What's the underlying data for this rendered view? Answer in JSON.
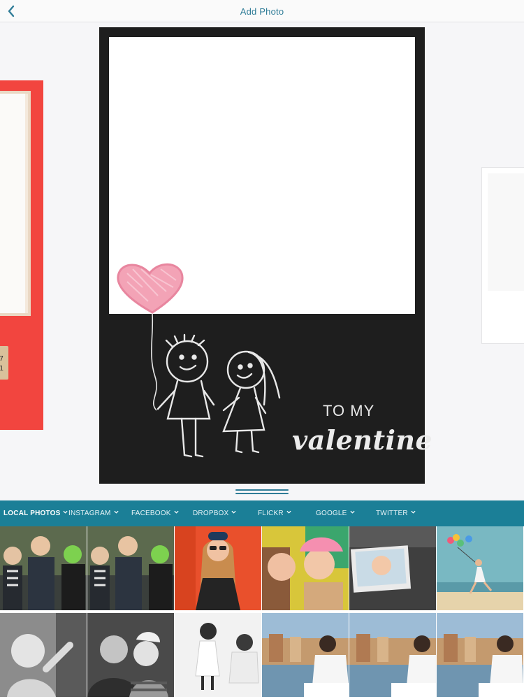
{
  "header": {
    "title": "Add Photo",
    "back_icon": "chevron-left-icon"
  },
  "colors": {
    "accent": "#2f7c97",
    "tab_bar": "#1b7f97",
    "chalkboard": "#1e1e1e",
    "left_card": "#f2453f"
  },
  "canvas": {
    "center_card": {
      "text_line1": "TO MY",
      "text_line2": "valentine"
    },
    "left_card": {
      "tag_text": "7\n1"
    }
  },
  "sources": {
    "tabs": [
      {
        "label": "LOCAL PHOTOS",
        "active": true
      },
      {
        "label": "INSTAGRAM",
        "active": false
      },
      {
        "label": "FACEBOOK",
        "active": false
      },
      {
        "label": "DROPBOX",
        "active": false
      },
      {
        "label": "FLICKR",
        "active": false
      },
      {
        "label": "GOOGLE",
        "active": false
      },
      {
        "label": "TWITTER",
        "active": false
      }
    ]
  },
  "photos": {
    "row1": [
      "kids-halloween-costumes-1",
      "kids-halloween-costumes-2",
      "woman-sunglasses-red-wall",
      "two-women-selfie",
      "baby-photo-print",
      "woman-balloons-beach"
    ],
    "row2": [
      "baby-black-and-white",
      "father-child-kiss-bw",
      "parent-child-bw",
      "woman-breakfast-venice-1",
      "woman-breakfast-venice-2",
      "woman-breakfast-venice-3"
    ]
  }
}
